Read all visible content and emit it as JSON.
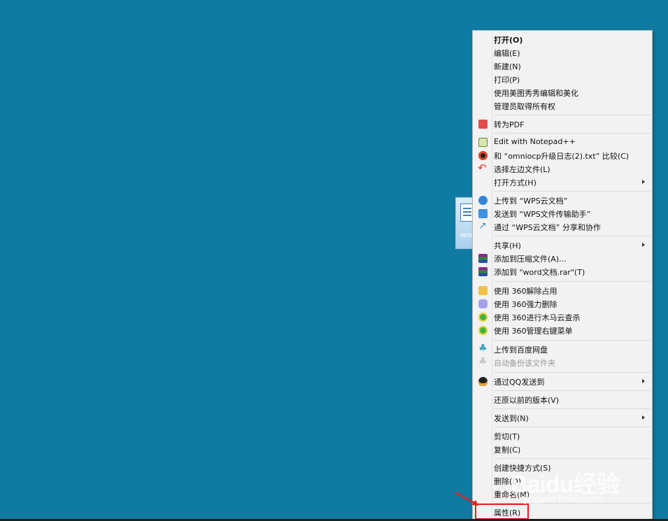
{
  "desktop_file": {
    "label": "wor"
  },
  "context_menu": {
    "items": [
      {
        "label": "打开(O)",
        "bold": true,
        "icon": ""
      },
      {
        "label": "编辑(E)",
        "icon": ""
      },
      {
        "label": "新建(N)",
        "icon": ""
      },
      {
        "label": "打印(P)",
        "icon": ""
      },
      {
        "label": "使用美图秀秀编辑和美化",
        "icon": ""
      },
      {
        "label": "管理员取得所有权",
        "icon": ""
      },
      {
        "label": "转为PDF",
        "icon": "pdf-icon"
      },
      {
        "label": "Edit with Notepad++",
        "icon": "notepad-icon"
      },
      {
        "label": "和 “omniocp升级日志(2).txt” 比较(C)",
        "icon": "compare-icon"
      },
      {
        "label": "选择左边文件(L)",
        "icon": "undo-arrow-icon"
      },
      {
        "label": "打开方式(H)",
        "icon": "",
        "submenu": true
      },
      {
        "label": "上传到 “WPS云文档”",
        "icon": "cloud-upload-icon"
      },
      {
        "label": "发送到 “WPS文件传输助手”",
        "icon": "send-icon"
      },
      {
        "label": "通过 “WPS云文档” 分享和协作",
        "icon": "share-icon"
      },
      {
        "label": "共享(H)",
        "icon": "",
        "submenu": true
      },
      {
        "label": "添加到压缩文件(A)...",
        "icon": "winrar-icon"
      },
      {
        "label": "添加到 \"word文档.rar\"(T)",
        "icon": "winrar-icon"
      },
      {
        "label": "使用 360解除占用",
        "icon": "folder-360-icon"
      },
      {
        "label": "使用 360强力删除",
        "icon": "shred-360-icon"
      },
      {
        "label": "使用 360进行木马云查杀",
        "icon": "shield-360-icon"
      },
      {
        "label": "使用 360管理右键菜单",
        "icon": "shield-360-icon"
      },
      {
        "label": "上传到百度网盘",
        "icon": "baidu-pan-icon"
      },
      {
        "label": "自动备份该文件夹",
        "icon": "baidu-pan-icon",
        "disabled": true
      },
      {
        "label": "通过QQ发送到",
        "icon": "qq-icon",
        "submenu": true
      },
      {
        "label": "还原以前的版本(V)",
        "icon": ""
      },
      {
        "label": "发送到(N)",
        "icon": "",
        "submenu": true
      },
      {
        "label": "剪切(T)",
        "icon": ""
      },
      {
        "label": "复制(C)",
        "icon": ""
      },
      {
        "label": "创建快捷方式(S)",
        "icon": ""
      },
      {
        "label": "删除(D)",
        "icon": ""
      },
      {
        "label": "重命名(M)",
        "icon": ""
      },
      {
        "label": "属性(R)",
        "icon": ""
      }
    ]
  },
  "watermark": {
    "logo": "Baidu经验",
    "sub": "jingyan.baidu.com"
  },
  "colors": {
    "desktop": "#0f7ba3",
    "menu_bg": "#f2f2f2",
    "highlight": "#e02020"
  }
}
